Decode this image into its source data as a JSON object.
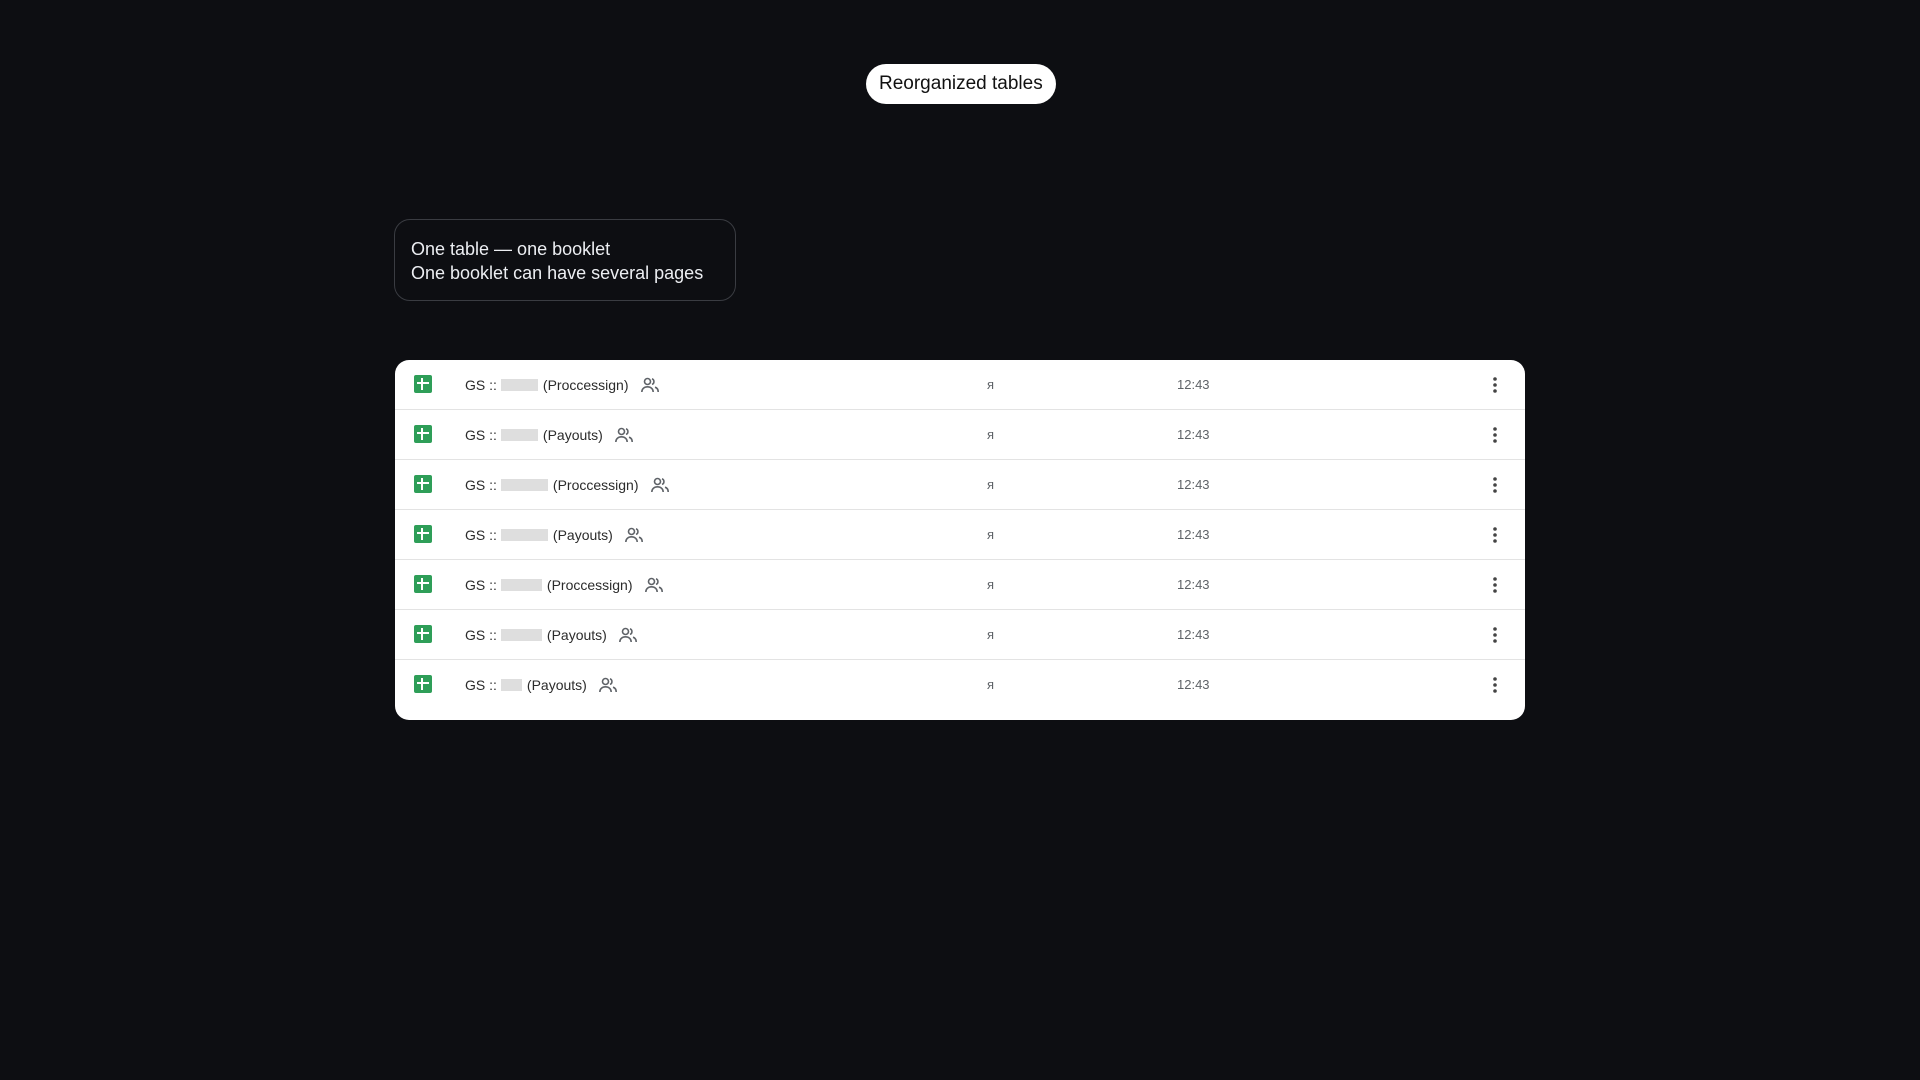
{
  "header": {
    "title": "Reorganized tables"
  },
  "note": {
    "line1": "One table — one booklet",
    "line2": "One booklet can have several pages"
  },
  "files": [
    {
      "prefix": "GS ::",
      "suffix": "(Proccessign)",
      "owner": "я",
      "time": "12:43",
      "icon": "sheets-icon",
      "shared_icon": "shared-people-icon"
    },
    {
      "prefix": "GS ::",
      "suffix": "(Payouts)",
      "owner": "я",
      "time": "12:43",
      "icon": "sheets-icon",
      "shared_icon": "shared-people-icon"
    },
    {
      "prefix": "GS ::",
      "suffix": "(Proccessign)",
      "owner": "я",
      "time": "12:43",
      "icon": "sheets-icon",
      "shared_icon": "shared-people-icon"
    },
    {
      "prefix": "GS ::",
      "suffix": "(Payouts)",
      "owner": "я",
      "time": "12:43",
      "icon": "sheets-icon",
      "shared_icon": "shared-people-icon"
    },
    {
      "prefix": "GS ::",
      "suffix": "(Proccessign)",
      "owner": "я",
      "time": "12:43",
      "icon": "sheets-icon",
      "shared_icon": "shared-people-icon"
    },
    {
      "prefix": "GS ::",
      "suffix": "(Payouts)",
      "owner": "я",
      "time": "12:43",
      "icon": "sheets-icon",
      "shared_icon": "shared-people-icon"
    },
    {
      "prefix": "GS ::",
      "suffix": "(Payouts)",
      "owner": "я",
      "time": "12:43",
      "icon": "sheets-icon",
      "shared_icon": "shared-people-icon"
    }
  ],
  "colors": {
    "background": "#0d0e12",
    "sheets_green": "#2e9e58",
    "redaction": "#dedede"
  }
}
